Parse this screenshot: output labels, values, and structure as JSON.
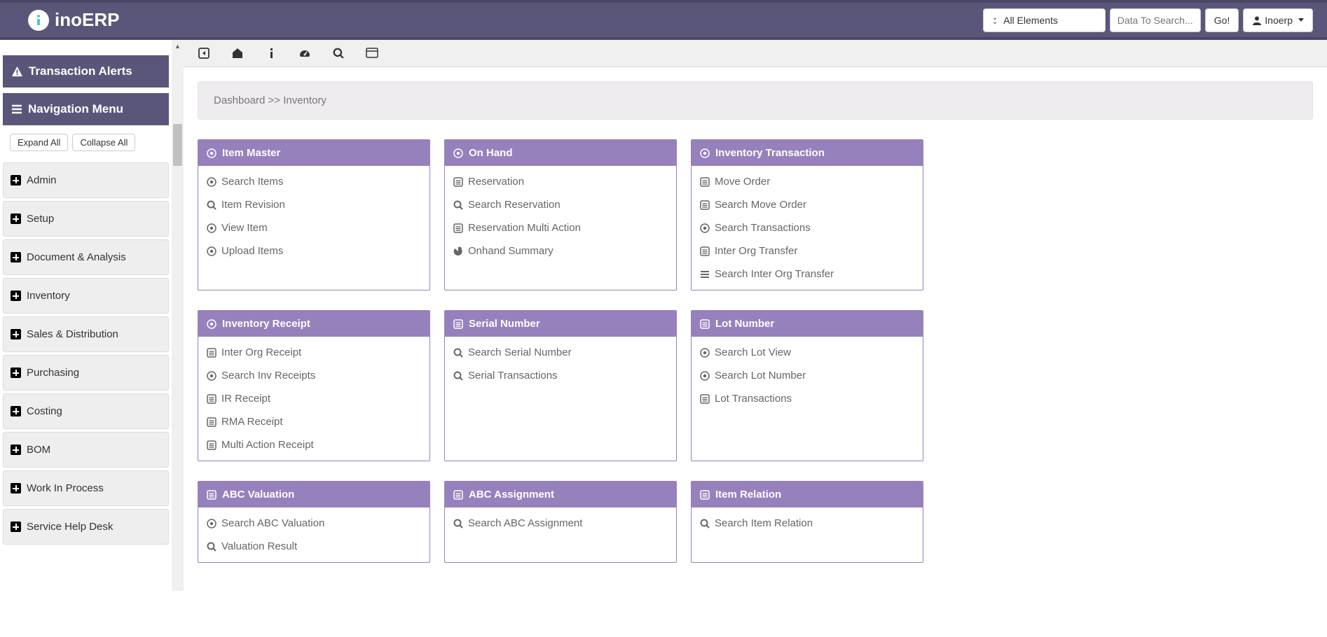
{
  "header": {
    "brand": "inoERP",
    "elements_btn": "All Elements",
    "search_placeholder": "Data To Search...",
    "go_btn": "Go!",
    "user_btn": "Inoerp"
  },
  "sidebar": {
    "alerts_title": "Transaction Alerts",
    "nav_title": "Navigation Menu",
    "expand": "Expand All",
    "collapse": "Collapse All",
    "items": [
      "Admin",
      "Setup",
      "Document & Analysis",
      "Inventory",
      "Sales & Distribution",
      "Purchasing",
      "Costing",
      "BOM",
      "Work In Process",
      "Service Help Desk"
    ]
  },
  "breadcrumb": "Dashboard >>   Inventory",
  "cards": [
    {
      "title": "Item Master",
      "hicon": "dot-circle",
      "links": [
        {
          "icon": "dot-circle",
          "label": "Search Items"
        },
        {
          "icon": "search",
          "label": "Item Revision"
        },
        {
          "icon": "dot-circle",
          "label": "View Item"
        },
        {
          "icon": "dot-circle",
          "label": "Upload Items"
        }
      ]
    },
    {
      "title": "On Hand",
      "hicon": "dot-circle",
      "links": [
        {
          "icon": "list",
          "label": "Reservation"
        },
        {
          "icon": "search",
          "label": "Search Reservation"
        },
        {
          "icon": "list",
          "label": "Reservation Multi Action"
        },
        {
          "icon": "pie",
          "label": "Onhand Summary"
        }
      ]
    },
    {
      "title": "Inventory Transaction",
      "hicon": "dot-circle",
      "links": [
        {
          "icon": "list",
          "label": "Move Order"
        },
        {
          "icon": "list",
          "label": "Search Move Order"
        },
        {
          "icon": "dot-circle",
          "label": "Search Transactions"
        },
        {
          "icon": "list",
          "label": "Inter Org Transfer"
        },
        {
          "icon": "lines",
          "label": "Search Inter Org Transfer"
        }
      ]
    },
    {
      "title": "Inventory Receipt",
      "hicon": "dot-circle",
      "links": [
        {
          "icon": "list",
          "label": "Inter Org Receipt"
        },
        {
          "icon": "dot-circle",
          "label": "Search Inv Receipts"
        },
        {
          "icon": "list",
          "label": "IR Receipt"
        },
        {
          "icon": "list",
          "label": "RMA Receipt"
        },
        {
          "icon": "list",
          "label": "Multi Action Receipt"
        }
      ]
    },
    {
      "title": "Serial Number",
      "hicon": "list",
      "links": [
        {
          "icon": "search",
          "label": "Search Serial Number"
        },
        {
          "icon": "search",
          "label": "Serial Transactions"
        }
      ]
    },
    {
      "title": "Lot Number",
      "hicon": "list",
      "links": [
        {
          "icon": "dot-circle",
          "label": "Search Lot View"
        },
        {
          "icon": "dot-circle",
          "label": "Search Lot Number"
        },
        {
          "icon": "list",
          "label": "Lot Transactions"
        }
      ]
    },
    {
      "title": "ABC Valuation",
      "hicon": "list",
      "links": [
        {
          "icon": "dot-circle",
          "label": "Search ABC Valuation"
        },
        {
          "icon": "search",
          "label": "Valuation Result"
        }
      ]
    },
    {
      "title": "ABC Assignment",
      "hicon": "list",
      "links": [
        {
          "icon": "search",
          "label": "Search ABC Assignment"
        }
      ]
    },
    {
      "title": "Item Relation",
      "hicon": "list",
      "links": [
        {
          "icon": "search",
          "label": "Search Item Relation"
        }
      ]
    }
  ]
}
